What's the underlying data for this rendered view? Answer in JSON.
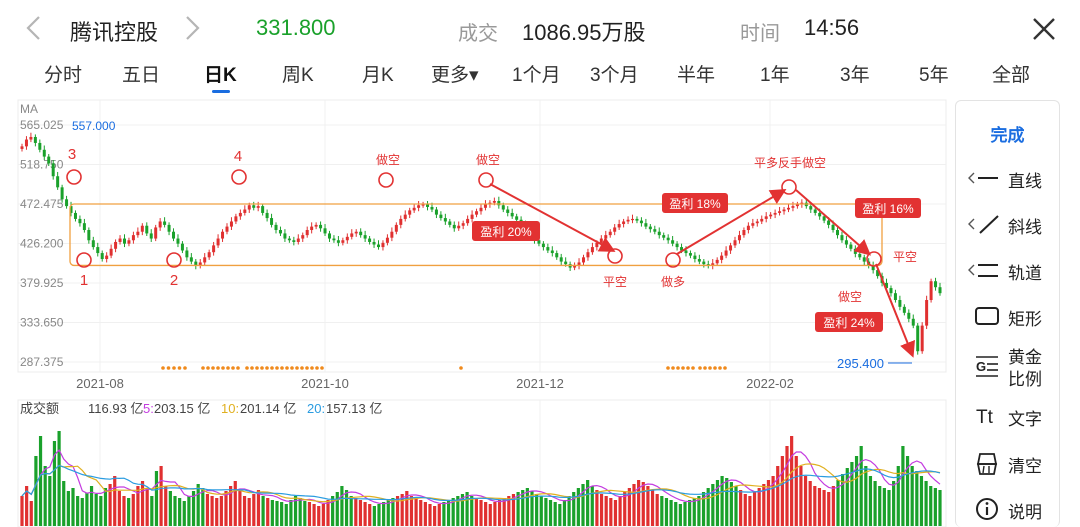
{
  "header": {
    "name": "腾讯控股",
    "price": "331.800",
    "volume_label": "成交",
    "volume_value": "1086.95万股",
    "time_label": "时间",
    "time_value": "14:56",
    "price_color": "#1aa12b"
  },
  "tabs": [
    "分时",
    "五日",
    "日K",
    "周K",
    "月K",
    "更多▾",
    "1个月",
    "3个月",
    "半年",
    "1年",
    "3年",
    "5年",
    "全部"
  ],
  "active_tab": "日K",
  "chart_data": {
    "type": "candlestick",
    "indicator": "MA",
    "y_ticks": [
      "565.025",
      "518.750",
      "472.475",
      "426.200",
      "379.925",
      "333.650",
      "287.375"
    ],
    "x_ticks": [
      "2021-08",
      "2021-10",
      "2021-12",
      "2022-02"
    ],
    "max_label": "557.000",
    "min_label": "295.400",
    "channel": {
      "upper": 472.5,
      "lower": 400.5
    },
    "point_labels": [
      "1",
      "2",
      "3",
      "4"
    ],
    "annotations": {
      "short1": "做空",
      "short2": "做空",
      "cover1": "平空",
      "long1": "做多",
      "flip": "平多反手做空",
      "cover2": "平空",
      "short3": "做空",
      "profit1": "盈利 20%",
      "profit2": "盈利 18%",
      "profit3": "盈利 16%",
      "profit4": "盈利 24%"
    },
    "volume": {
      "title": "成交额",
      "current": "116.93 亿",
      "ma5_label": "5:",
      "ma5": "203.15 亿",
      "ma10_label": "10:",
      "ma10": "201.14 亿",
      "ma20_label": "20:",
      "ma20": "157.13 亿",
      "colors": {
        "ma5": "#c43ce0",
        "ma10": "#e0b020",
        "ma20": "#2a9ce0"
      }
    },
    "colors": {
      "up": "#e03030",
      "down": "#1aa12b",
      "channel": "#f0a040",
      "annotation": "#e23232"
    }
  },
  "toolbar": {
    "done": "完成",
    "items": [
      "直线",
      "斜线",
      "轨道",
      "矩形",
      "黄金比例",
      "文字",
      "清空",
      "说明"
    ]
  }
}
